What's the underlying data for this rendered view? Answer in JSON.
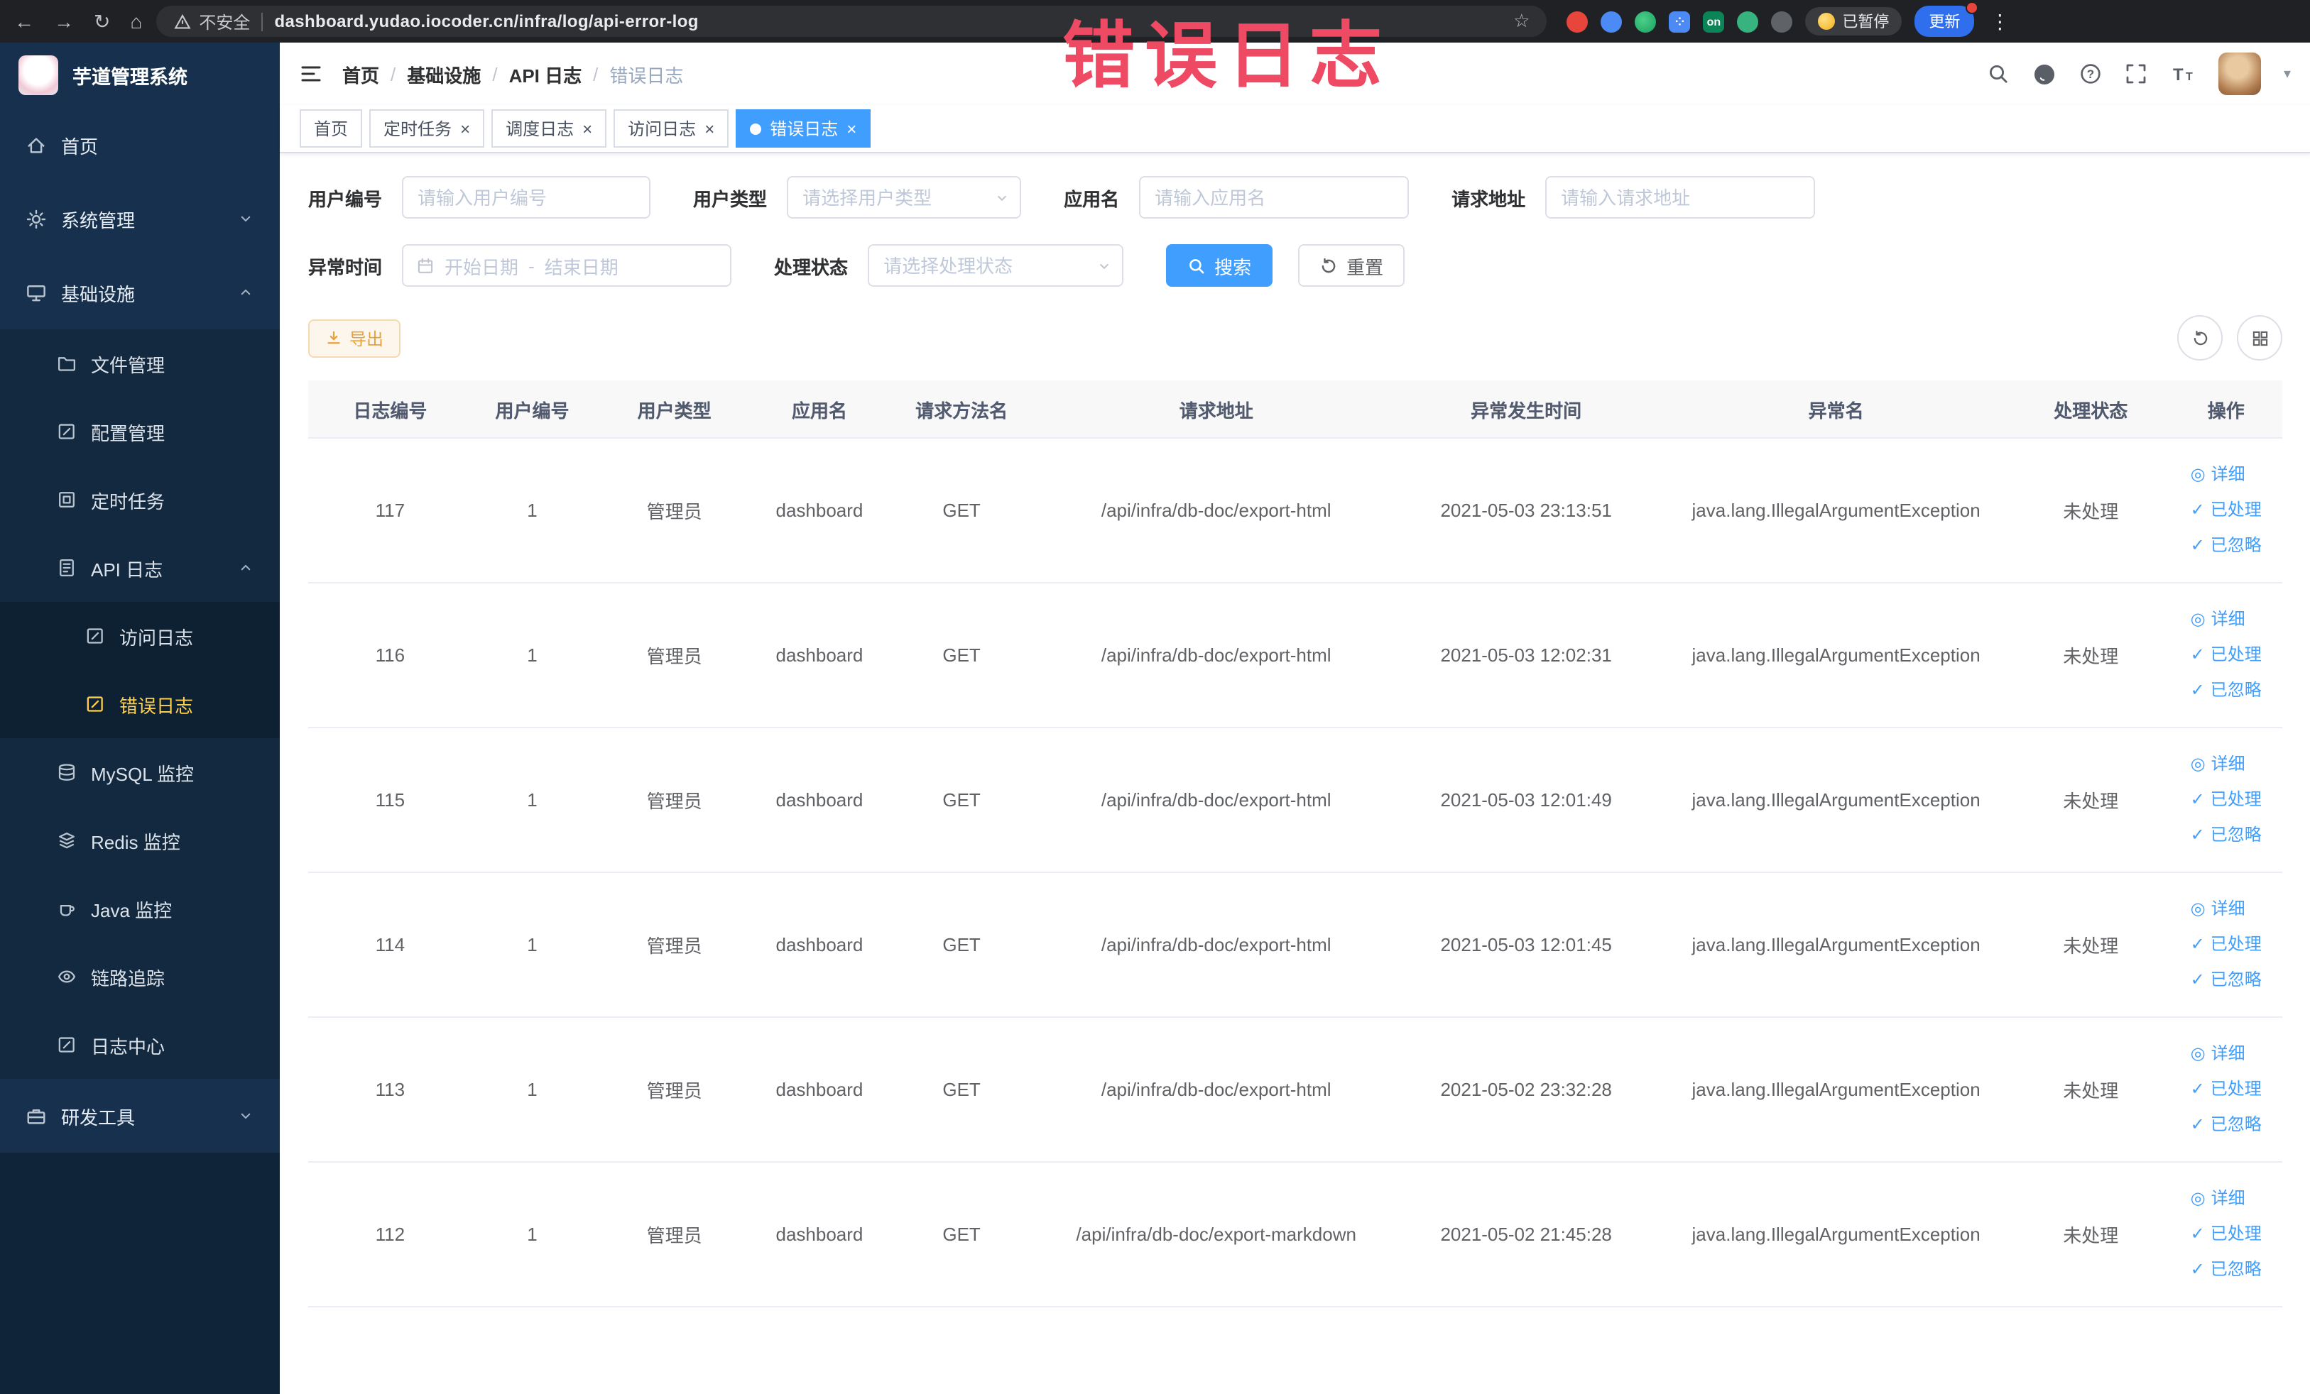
{
  "icons": {
    "back": "←",
    "forward": "→",
    "reload": "↻",
    "home": "⌂",
    "star": "☆",
    "more": "⋮",
    "close": "×",
    "dot": "●",
    "detail": "◎",
    "check": "✓",
    "dash": "-"
  },
  "browser": {
    "security": "不安全",
    "url": "dashboard.yudao.iocoder.cn/infra/log/api-error-log",
    "on_badge": "on",
    "paused": "已暂停",
    "update": "更新"
  },
  "annotation": "错误日志",
  "sidebar": {
    "title": "芋道管理系统",
    "items": [
      {
        "label": "首页"
      },
      {
        "label": "系统管理"
      },
      {
        "label": "基础设施"
      },
      {
        "label": "文件管理"
      },
      {
        "label": "配置管理"
      },
      {
        "label": "定时任务"
      },
      {
        "label": "API 日志"
      },
      {
        "label": "访问日志"
      },
      {
        "label": "错误日志"
      },
      {
        "label": "MySQL 监控"
      },
      {
        "label": "Redis 监控"
      },
      {
        "label": "Java 监控"
      },
      {
        "label": "链路追踪"
      },
      {
        "label": "日志中心"
      },
      {
        "label": "研发工具"
      }
    ]
  },
  "breadcrumb": {
    "items": [
      "首页",
      "基础设施",
      "API 日志",
      "错误日志"
    ]
  },
  "tabs": [
    {
      "label": "首页"
    },
    {
      "label": "定时任务"
    },
    {
      "label": "调度日志"
    },
    {
      "label": "访问日志"
    },
    {
      "label": "错误日志"
    }
  ],
  "filters": {
    "user_id_label": "用户编号",
    "user_id_placeholder": "请输入用户编号",
    "user_type_label": "用户类型",
    "user_type_placeholder": "请选择用户类型",
    "app_name_label": "应用名",
    "app_name_placeholder": "请输入应用名",
    "request_url_label": "请求地址",
    "request_url_placeholder": "请输入请求地址",
    "time_label": "异常时间",
    "time_start_placeholder": "开始日期",
    "time_end_placeholder": "结束日期",
    "status_label": "处理状态",
    "status_placeholder": "请选择处理状态",
    "search": "搜索",
    "reset": "重置"
  },
  "toolbar": {
    "export": "导出"
  },
  "table": {
    "columns": [
      "日志编号",
      "用户编号",
      "用户类型",
      "应用名",
      "请求方法名",
      "请求地址",
      "异常发生时间",
      "异常名",
      "处理状态",
      "操作"
    ],
    "actions": {
      "detail": "详细",
      "processed": "已处理",
      "ignored": "已忽略"
    },
    "rows": [
      {
        "id": "117",
        "user": "1",
        "type": "管理员",
        "app": "dashboard",
        "method": "GET",
        "url": "/api/infra/db-doc/export-html",
        "time": "2021-05-03 23:13:51",
        "exception": "java.lang.IllegalArgumentException",
        "status": "未处理"
      },
      {
        "id": "116",
        "user": "1",
        "type": "管理员",
        "app": "dashboard",
        "method": "GET",
        "url": "/api/infra/db-doc/export-html",
        "time": "2021-05-03 12:02:31",
        "exception": "java.lang.IllegalArgumentException",
        "status": "未处理"
      },
      {
        "id": "115",
        "user": "1",
        "type": "管理员",
        "app": "dashboard",
        "method": "GET",
        "url": "/api/infra/db-doc/export-html",
        "time": "2021-05-03 12:01:49",
        "exception": "java.lang.IllegalArgumentException",
        "status": "未处理"
      },
      {
        "id": "114",
        "user": "1",
        "type": "管理员",
        "app": "dashboard",
        "method": "GET",
        "url": "/api/infra/db-doc/export-html",
        "time": "2021-05-03 12:01:45",
        "exception": "java.lang.IllegalArgumentException",
        "status": "未处理"
      },
      {
        "id": "113",
        "user": "1",
        "type": "管理员",
        "app": "dashboard",
        "method": "GET",
        "url": "/api/infra/db-doc/export-html",
        "time": "2021-05-02 23:32:28",
        "exception": "java.lang.IllegalArgumentException",
        "status": "未处理"
      },
      {
        "id": "112",
        "user": "1",
        "type": "管理员",
        "app": "dashboard",
        "method": "GET",
        "url": "/api/infra/db-doc/export-markdown",
        "time": "2021-05-02 21:45:28",
        "exception": "java.lang.IllegalArgumentException",
        "status": "未处理"
      }
    ]
  }
}
